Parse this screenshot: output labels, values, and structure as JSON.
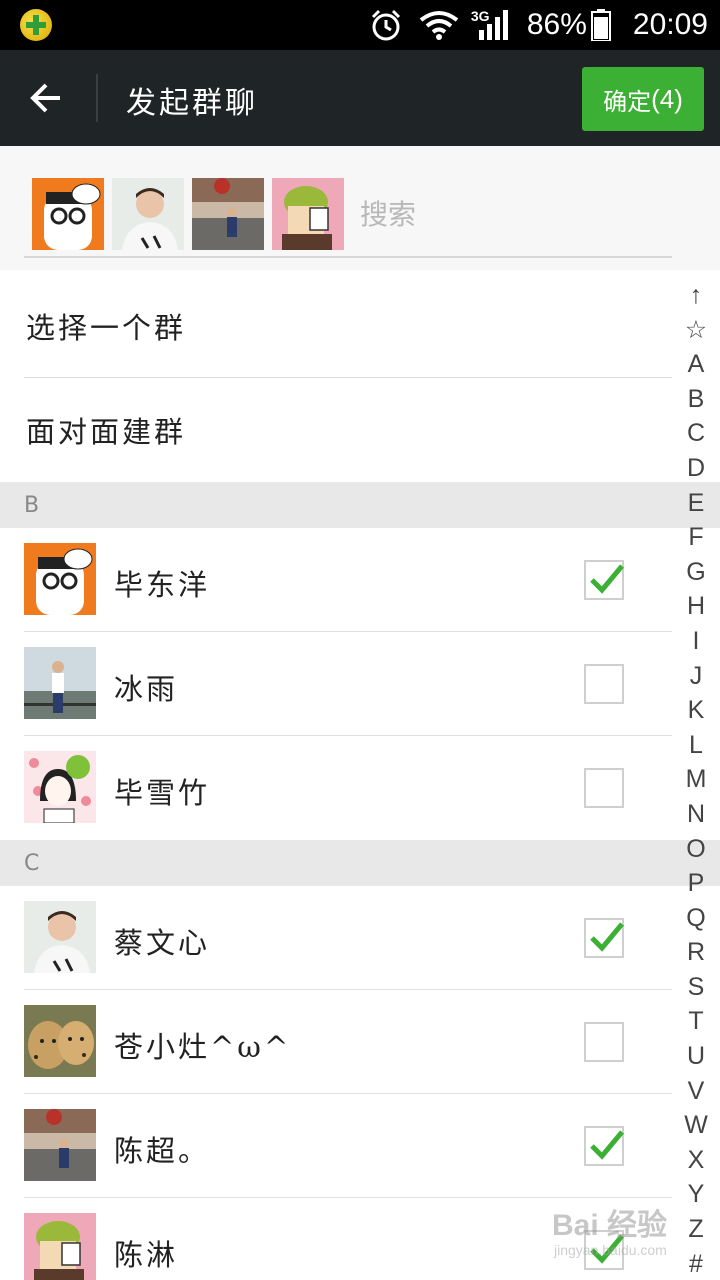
{
  "status_bar": {
    "network_type": "3G",
    "battery_percent": "86%",
    "time": "20:09",
    "icons": [
      "app-icon",
      "alarm-icon",
      "wifi-icon",
      "signal-icon",
      "battery-icon"
    ]
  },
  "header": {
    "title": "发起群聊",
    "confirm_label": "确定",
    "confirm_count": "(4)",
    "accent_color": "#3cb034"
  },
  "search": {
    "placeholder": "搜索",
    "value": ""
  },
  "actions": [
    {
      "label": "选择一个群"
    },
    {
      "label": "面对面建群"
    }
  ],
  "sections": [
    {
      "letter": "B",
      "contacts": [
        {
          "name": "毕东洋",
          "checked": true
        },
        {
          "name": "冰雨",
          "checked": false
        },
        {
          "name": "毕雪竹",
          "checked": false
        }
      ]
    },
    {
      "letter": "C",
      "contacts": [
        {
          "name": "蔡文心",
          "checked": true
        },
        {
          "name": "苍小灶^ω^",
          "checked": false
        },
        {
          "name": "陈超。",
          "checked": true
        },
        {
          "name": "陈淋",
          "checked": true
        }
      ]
    }
  ],
  "index_letters": [
    "↑",
    "☆",
    "A",
    "B",
    "C",
    "D",
    "E",
    "F",
    "G",
    "H",
    "I",
    "J",
    "K",
    "L",
    "M",
    "N",
    "O",
    "P",
    "Q",
    "R",
    "S",
    "T",
    "U",
    "V",
    "W",
    "X",
    "Y",
    "Z",
    "#"
  ],
  "watermark": {
    "text": "Bai 经验",
    "sub": "jingyan.baidu.com"
  }
}
